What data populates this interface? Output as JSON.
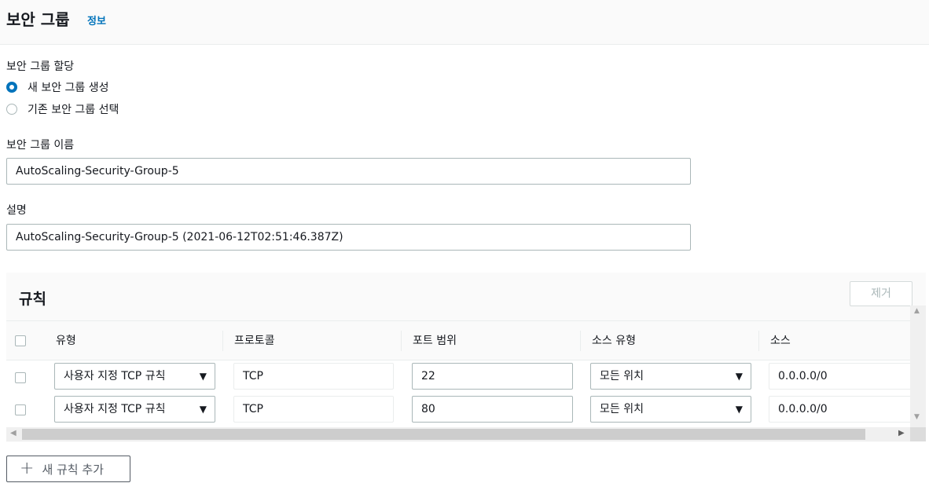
{
  "header": {
    "title": "보안 그룹",
    "info_link": "정보"
  },
  "assignment": {
    "label": "보안 그룹 할당",
    "options": [
      {
        "label": "새 보안 그룹 생성",
        "checked": true
      },
      {
        "label": "기존 보안 그룹 선택",
        "checked": false
      }
    ]
  },
  "name_field": {
    "label": "보안 그룹 이름",
    "value": "AutoScaling-Security-Group-5"
  },
  "desc_field": {
    "label": "설명",
    "value": "AutoScaling-Security-Group-5 (2021-06-12T02:51:46.387Z)"
  },
  "rules": {
    "title": "규칙",
    "remove_label": "제거",
    "columns": [
      "유형",
      "프로토콜",
      "포트 범위",
      "소스 유형",
      "소스"
    ],
    "rows": [
      {
        "type": "사용자 지정 TCP 규칙",
        "protocol": "TCP",
        "port": "22",
        "source_type": "모든 위치",
        "source": "0.0.0.0/0"
      },
      {
        "type": "사용자 지정 TCP 규칙",
        "protocol": "TCP",
        "port": "80",
        "source_type": "모든 위치",
        "source": "0.0.0.0/0"
      }
    ],
    "add_label": "새 규칙 추가"
  },
  "colors": {
    "accent": "#0073bb",
    "header_bg": "#fafafa",
    "border": "#aab7b8"
  },
  "icons": {
    "dropdown": "caret-down-icon",
    "add": "plus-icon"
  }
}
